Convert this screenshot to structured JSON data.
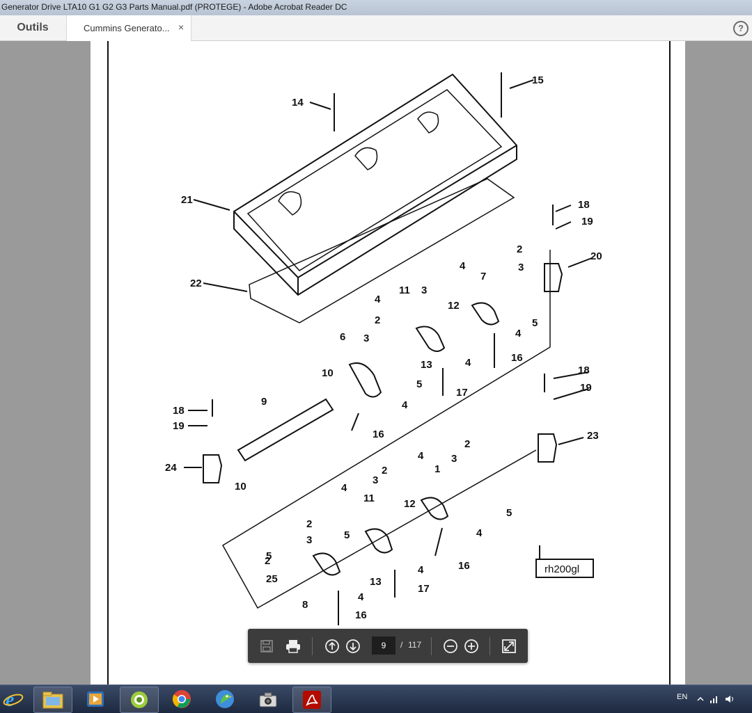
{
  "window": {
    "title": "Generator Drive LTA10 G1 G2 G3 Parts Manual.pdf (PROTEGE) - Adobe Acrobat Reader DC"
  },
  "tabs": {
    "tools_label": "Outils",
    "document_tab": {
      "label": "Cummins Generato...",
      "close": "×"
    },
    "help": "?"
  },
  "document": {
    "figure_id": "rh200gl",
    "callouts": [
      "14",
      "15",
      "21",
      "22",
      "18",
      "19",
      "20",
      "2",
      "4",
      "3",
      "7",
      "11",
      "3",
      "12",
      "5",
      "4",
      "2",
      "4",
      "6",
      "3",
      "13",
      "4",
      "5",
      "16",
      "17",
      "10",
      "9",
      "4",
      "16",
      "18",
      "19",
      "23",
      "18",
      "19",
      "24",
      "10",
      "2",
      "4",
      "1",
      "3",
      "2",
      "3",
      "11",
      "12",
      "5",
      "4",
      "2",
      "3",
      "5",
      "4",
      "16",
      "25",
      "13",
      "4",
      "4",
      "8",
      "17",
      "16",
      "2",
      "5"
    ]
  },
  "toolbar": {
    "page_current": "9",
    "page_separator": "/",
    "page_total": "117",
    "icons": [
      "save-icon",
      "print-icon",
      "page-up-icon",
      "page-down-icon",
      "zoom-out-icon",
      "zoom-in-icon",
      "fit-page-icon"
    ]
  },
  "taskbar": {
    "apps": [
      "internet-explorer-icon",
      "file-explorer-icon",
      "media-player-icon",
      "app-icon",
      "chrome-icon",
      "app-parrot-icon",
      "camera-icon",
      "acrobat-icon"
    ],
    "language": "EN"
  }
}
